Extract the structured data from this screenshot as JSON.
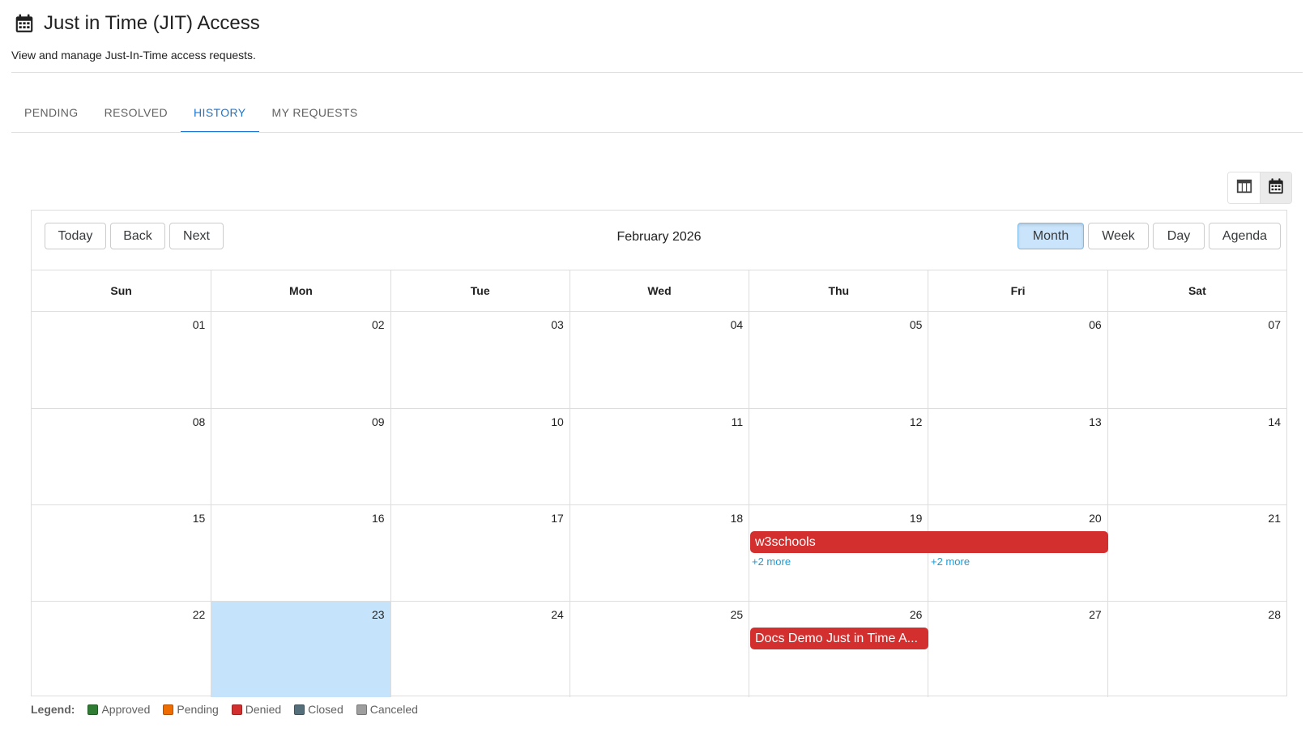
{
  "header": {
    "title": "Just in Time (JIT) Access",
    "subtitle": "View and manage Just-In-Time access requests.",
    "icon": "calendar-icon"
  },
  "tabs": [
    {
      "label": "PENDING",
      "active": false
    },
    {
      "label": "RESOLVED",
      "active": false
    },
    {
      "label": "HISTORY",
      "active": true
    },
    {
      "label": "MY REQUESTS",
      "active": false
    }
  ],
  "view_toggle": {
    "options": [
      {
        "icon": "table-view-icon",
        "selected": false
      },
      {
        "icon": "calendar-view-icon",
        "selected": true
      }
    ]
  },
  "calendar": {
    "label": "February 2026",
    "nav": {
      "today": "Today",
      "back": "Back",
      "next": "Next"
    },
    "views": {
      "month": "Month",
      "week": "Week",
      "day": "Day",
      "agenda": "Agenda"
    },
    "active_view": "Month",
    "weekdays": [
      "Sun",
      "Mon",
      "Tue",
      "Wed",
      "Thu",
      "Fri",
      "Sat"
    ],
    "weeks": [
      [
        "01",
        "02",
        "03",
        "04",
        "05",
        "06",
        "07"
      ],
      [
        "08",
        "09",
        "10",
        "11",
        "12",
        "13",
        "14"
      ],
      [
        "15",
        "16",
        "17",
        "18",
        "19",
        "20",
        "21"
      ],
      [
        "22",
        "23",
        "24",
        "25",
        "26",
        "27",
        "28"
      ]
    ],
    "today": "23",
    "events": {
      "w3schools": {
        "title": "w3schools",
        "status": "Denied"
      },
      "docs_demo": {
        "title": "Docs Demo Just in Time A...",
        "status": "Denied"
      }
    },
    "more_links": {
      "thu": "+2 more",
      "fri": "+2 more"
    }
  },
  "legend": {
    "title": "Legend:",
    "items": [
      {
        "label": "Approved",
        "color": "#2e7d32"
      },
      {
        "label": "Pending",
        "color": "#ef6c00"
      },
      {
        "label": "Denied",
        "color": "#d32f2f"
      },
      {
        "label": "Closed",
        "color": "#546e7a"
      },
      {
        "label": "Canceled",
        "color": "#9e9e9e"
      }
    ]
  },
  "colors": {
    "accent": "#1976d2",
    "denied": "#d32f2f",
    "today_bg": "#c5e3fb",
    "more_link": "#1a9ad6"
  }
}
